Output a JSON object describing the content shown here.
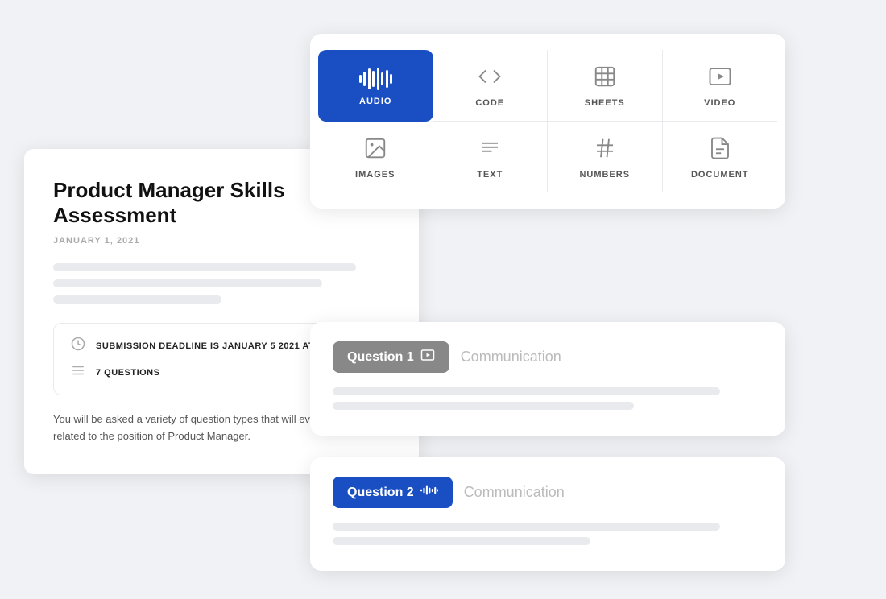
{
  "product_manager_card": {
    "title": "Product Manager\nSkills Assessment",
    "date": "JANUARY 1, 2021",
    "deadline_label": "SUBMISSION DEADLINE IS JANUARY 5 2021 AT",
    "questions_label": "7 QUESTIONS",
    "description": "You will be asked a variety of question types that will evaluate\nand skills related to the position of Product Manager."
  },
  "media_types": {
    "items": [
      {
        "id": "audio",
        "label": "AUDIO",
        "active": true
      },
      {
        "id": "code",
        "label": "CODE",
        "active": false
      },
      {
        "id": "sheets",
        "label": "SHEETS",
        "active": false
      },
      {
        "id": "video",
        "label": "VIDEO",
        "active": false
      },
      {
        "id": "images",
        "label": "IMAGES",
        "active": false
      },
      {
        "id": "text",
        "label": "TEXT",
        "active": false
      },
      {
        "id": "numbers",
        "label": "NUMBERS",
        "active": false
      },
      {
        "id": "document",
        "label": "DOCUMENT",
        "active": false
      }
    ]
  },
  "questions": [
    {
      "id": "q1",
      "label": "Question 1",
      "type": "video",
      "category": "Communication",
      "active": false
    },
    {
      "id": "q2",
      "label": "Question 2",
      "type": "audio",
      "category": "Communication",
      "active": true
    }
  ],
  "colors": {
    "accent": "#1a4fc4",
    "inactive_badge": "#888888",
    "skeleton": "#e8eaed"
  }
}
